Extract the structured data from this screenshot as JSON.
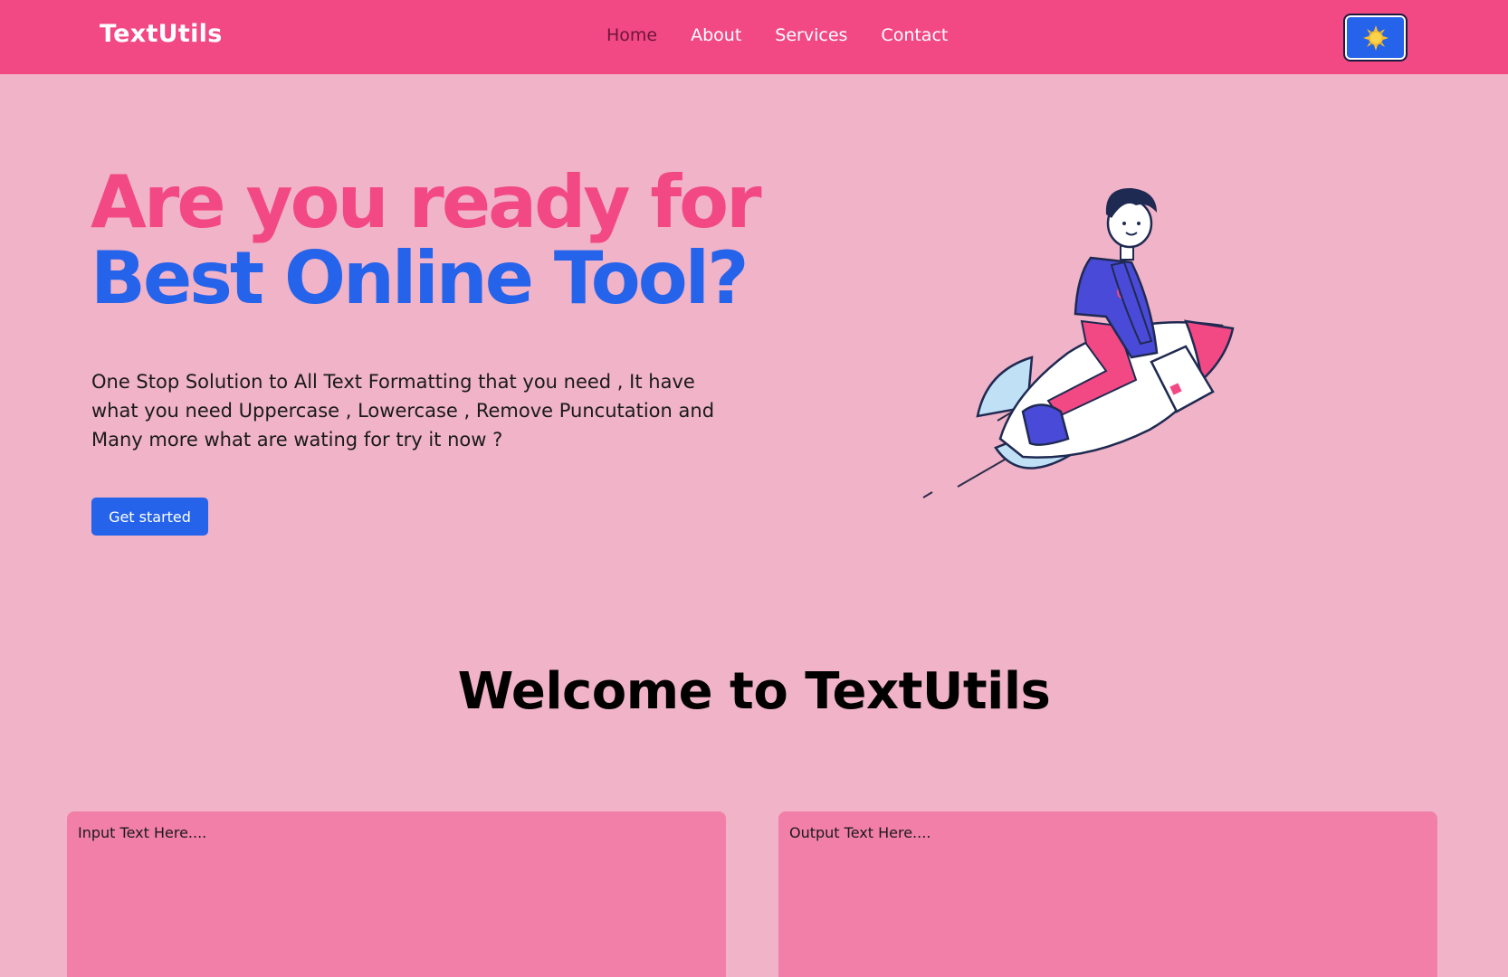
{
  "navbar": {
    "brand": "TextUtils",
    "links": [
      "Home",
      "About",
      "Services",
      "Contact"
    ],
    "theme_toggle_icon": "sun-icon"
  },
  "hero": {
    "title_line1": "Are you ready for",
    "title_line2": "Best Online Tool?",
    "description": "One Stop Solution to All Text Formatting that you need , It have what you need Uppercase , Lowercase , Remove Puncutation and Many more what are wating for try it now ?",
    "cta_label": "Get started",
    "illustration": "rocket-rider-illustration"
  },
  "section": {
    "title": "Welcome to TextUtils"
  },
  "editor": {
    "input_placeholder": "Input Text Here....",
    "output_placeholder": "Output Text Here...."
  },
  "colors": {
    "navbar_bg": "#f24985",
    "page_bg": "#f0b3c7",
    "accent_pink": "#f24985",
    "accent_blue": "#2563eb",
    "textarea_bg": "#f27fa8"
  }
}
